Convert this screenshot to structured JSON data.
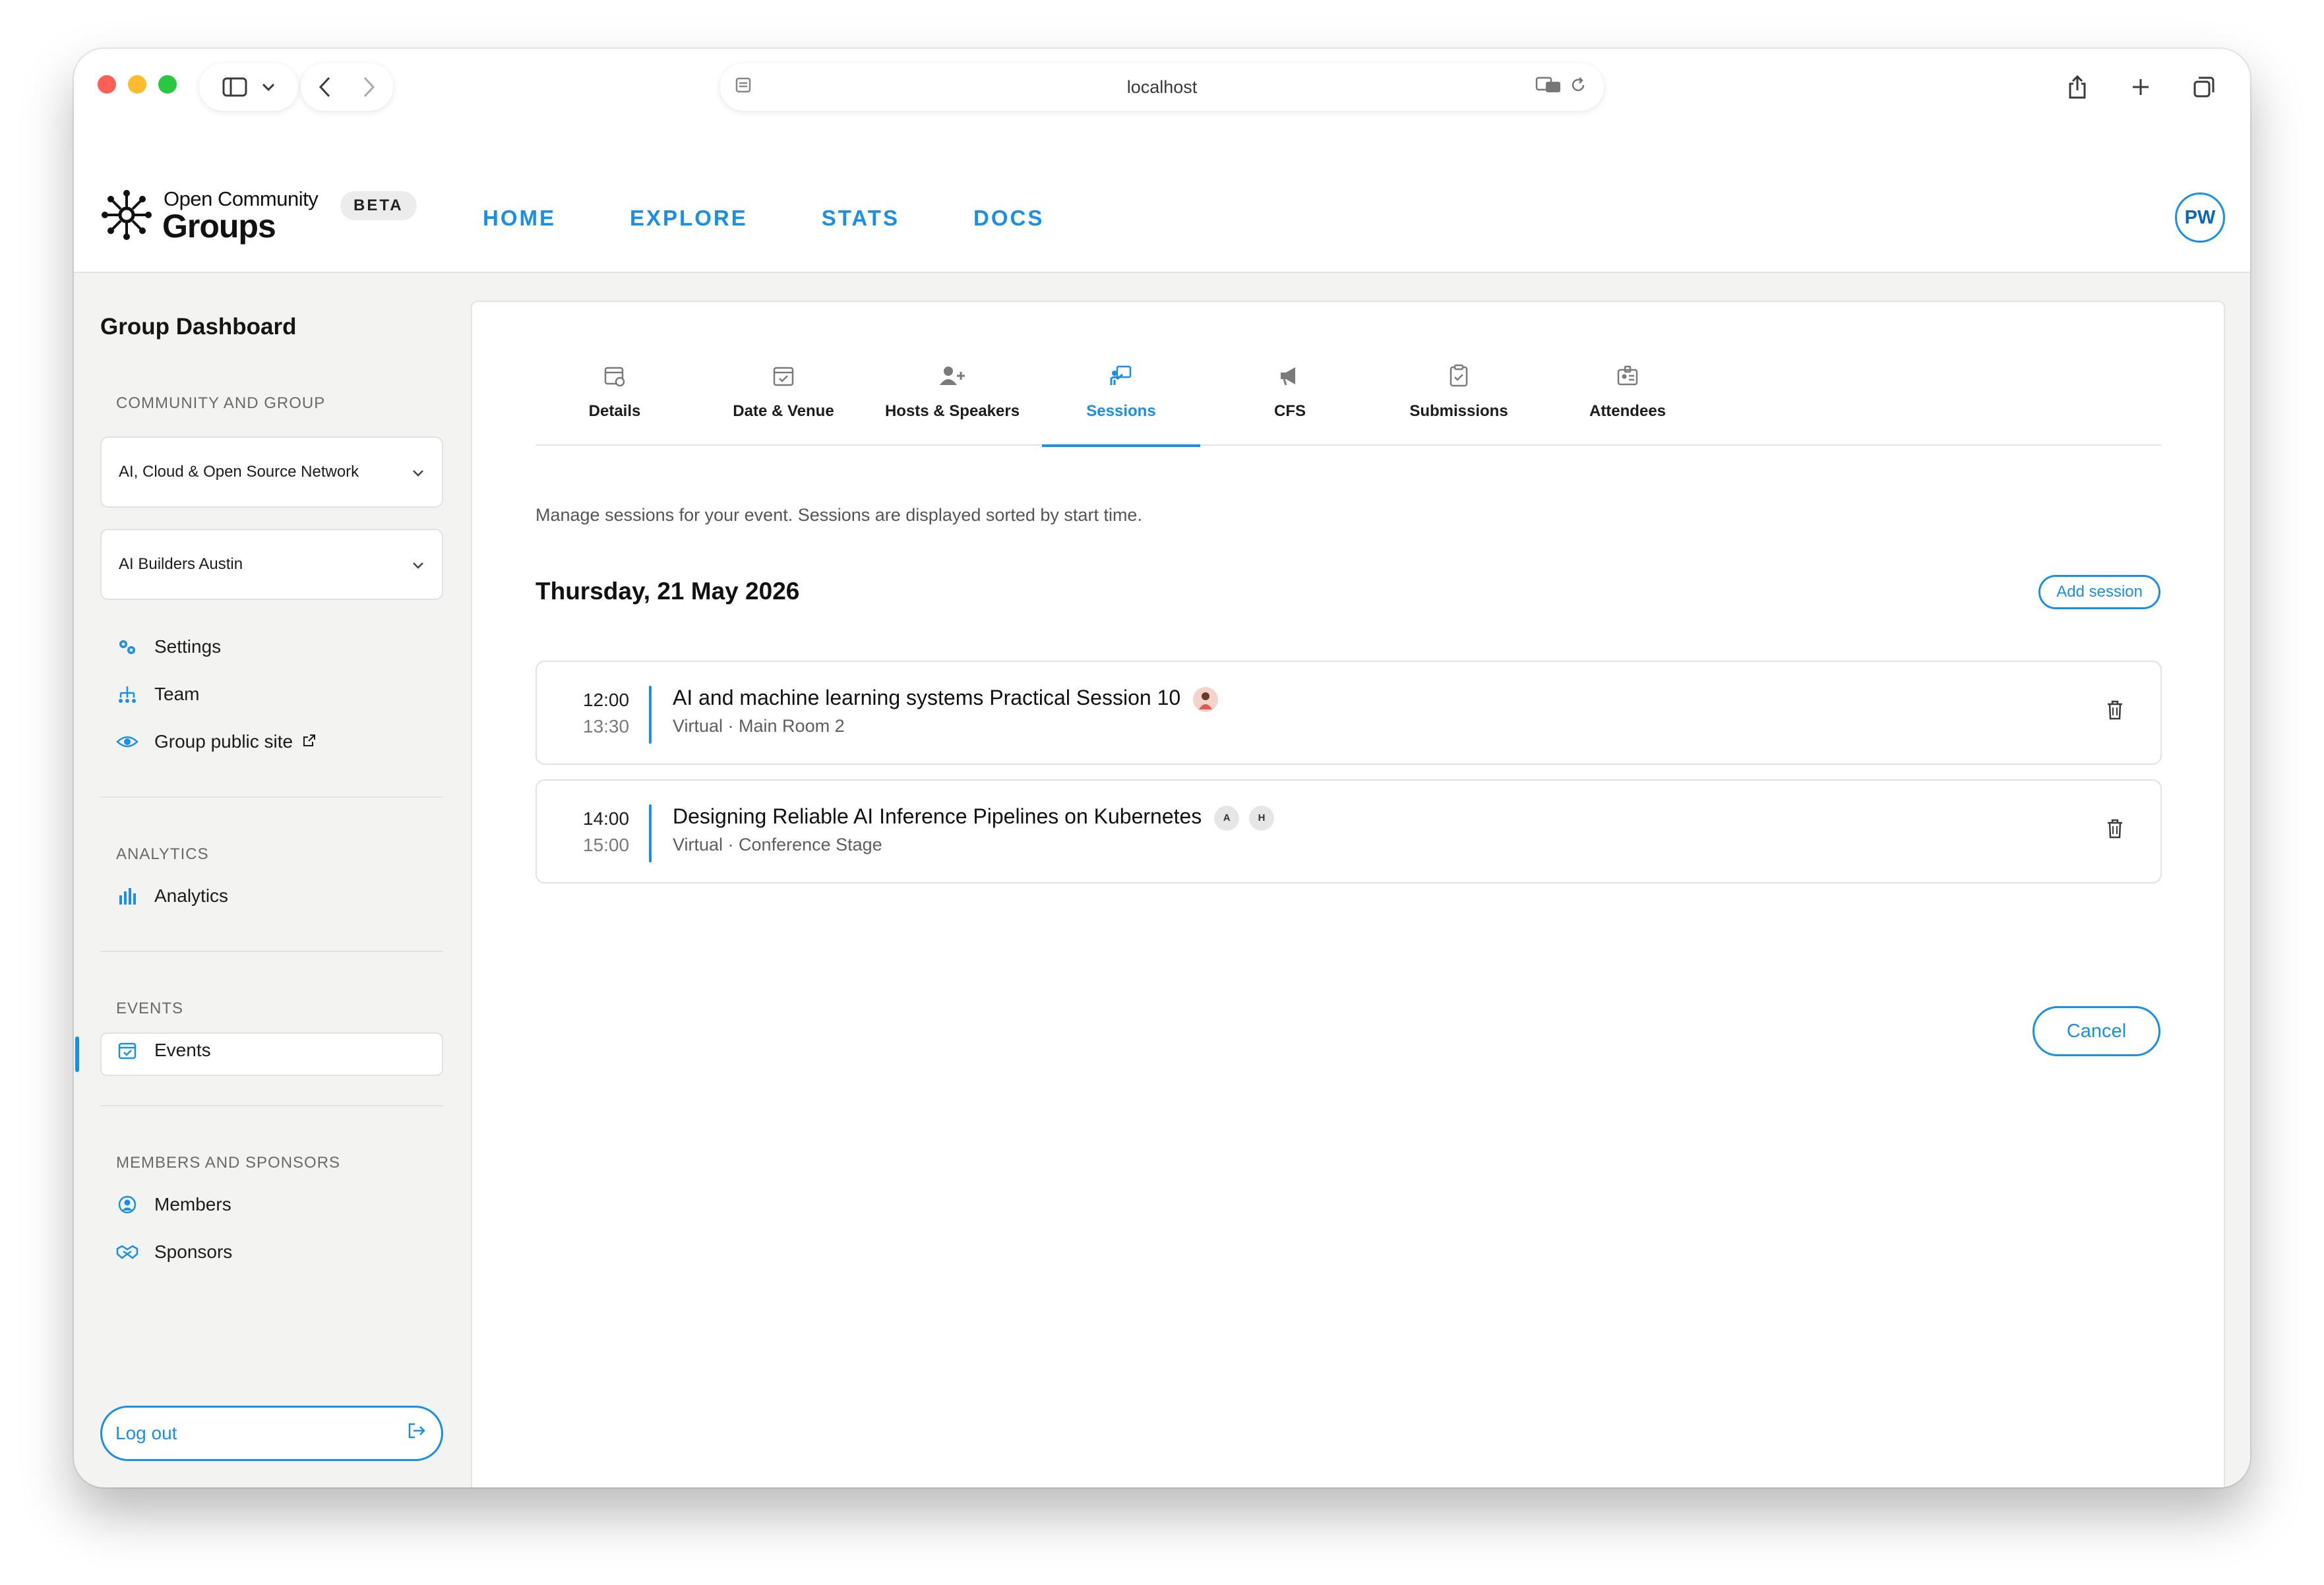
{
  "browser": {
    "url": "localhost",
    "icons": [
      "sidebar-icon",
      "chevron-down-icon",
      "back-icon",
      "forward-icon",
      "reader-icon",
      "translate-icon",
      "reload-icon",
      "share-icon",
      "new-tab-icon",
      "tabs-icon"
    ]
  },
  "header": {
    "brand_top": "Open Community",
    "brand_main": "Groups",
    "badge": "BETA",
    "nav": [
      "HOME",
      "EXPLORE",
      "STATS",
      "DOCS"
    ],
    "avatar_initials": "PW",
    "accent": "#1a8fe8"
  },
  "sidebar": {
    "title": "Group Dashboard",
    "sections": {
      "community_group": "COMMUNITY AND GROUP",
      "analytics": "ANALYTICS",
      "events": "EVENTS",
      "members_sponsors": "MEMBERS AND SPONSORS"
    },
    "community_select": "AI, Cloud & Open Source Network",
    "group_select": "AI Builders Austin",
    "items": {
      "settings": "Settings",
      "team": "Team",
      "public_site": "Group public site",
      "analytics": "Analytics",
      "events": "Events",
      "members": "Members",
      "sponsors": "Sponsors"
    },
    "logout": "Log out"
  },
  "main": {
    "tabs": [
      {
        "label": "Details",
        "icon": "calendar-gear-icon"
      },
      {
        "label": "Date & Venue",
        "icon": "calendar-check-icon"
      },
      {
        "label": "Hosts & Speakers",
        "icon": "user-plus-icon"
      },
      {
        "label": "Sessions",
        "icon": "presenter-icon",
        "active": true
      },
      {
        "label": "CFS",
        "icon": "megaphone-icon"
      },
      {
        "label": "Submissions",
        "icon": "clipboard-check-icon"
      },
      {
        "label": "Attendees",
        "icon": "id-badge-icon"
      }
    ],
    "description": "Manage sessions for your event. Sessions are displayed sorted by start time.",
    "day": "Thursday, 21 May 2026",
    "add_session": "Add session",
    "sessions": [
      {
        "start": "12:00",
        "end": "13:30",
        "title": "AI and machine learning systems Practical Session 10",
        "location": "Virtual · Main Room 2",
        "speakers": []
      },
      {
        "start": "14:00",
        "end": "15:00",
        "title": "Designing Reliable AI Inference Pipelines on Kubernetes",
        "location": "Virtual · Conference Stage",
        "speakers": [
          "A",
          "H"
        ]
      }
    ],
    "cancel": "Cancel"
  }
}
